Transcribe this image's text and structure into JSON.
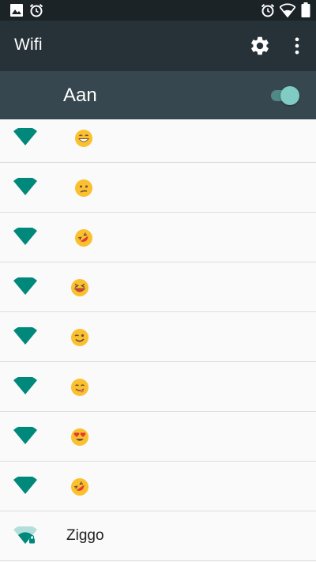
{
  "status_bar": {
    "left_icons": [
      "image-icon",
      "alarm-icon"
    ],
    "right_icons": [
      "alarm-icon",
      "wifi-signal-icon",
      "battery-icon"
    ]
  },
  "app_bar": {
    "title": "Wifi",
    "actions": [
      "settings-gear-icon",
      "overflow-menu-icon"
    ]
  },
  "switch_bar": {
    "label": "Aan",
    "enabled": true
  },
  "colors": {
    "status_bar": "#1b2327",
    "app_bar": "#263238",
    "switch_bar": "#37474f",
    "wifi_teal": "#00897b",
    "switch_thumb": "#80cbc4"
  },
  "networks": [
    {
      "name_emoji": "grinning-face-emoji",
      "signal": "full"
    },
    {
      "name_emoji": "confused-face-emoji",
      "signal": "full"
    },
    {
      "name_emoji": "rolling-on-floor-laughing-emoji",
      "signal": "full"
    },
    {
      "name_emoji": "laughing-squinting-face-emoji",
      "signal": "full"
    },
    {
      "name_emoji": "winking-face-emoji",
      "signal": "full"
    },
    {
      "name_emoji": "face-savoring-food-emoji",
      "signal": "full"
    },
    {
      "name_emoji": "heart-eyes-face-emoji",
      "signal": "full"
    },
    {
      "name_emoji": "rolling-on-floor-laughing-emoji",
      "signal": "full"
    },
    {
      "name": "Ziggo",
      "signal": "weak",
      "secured": true
    }
  ]
}
